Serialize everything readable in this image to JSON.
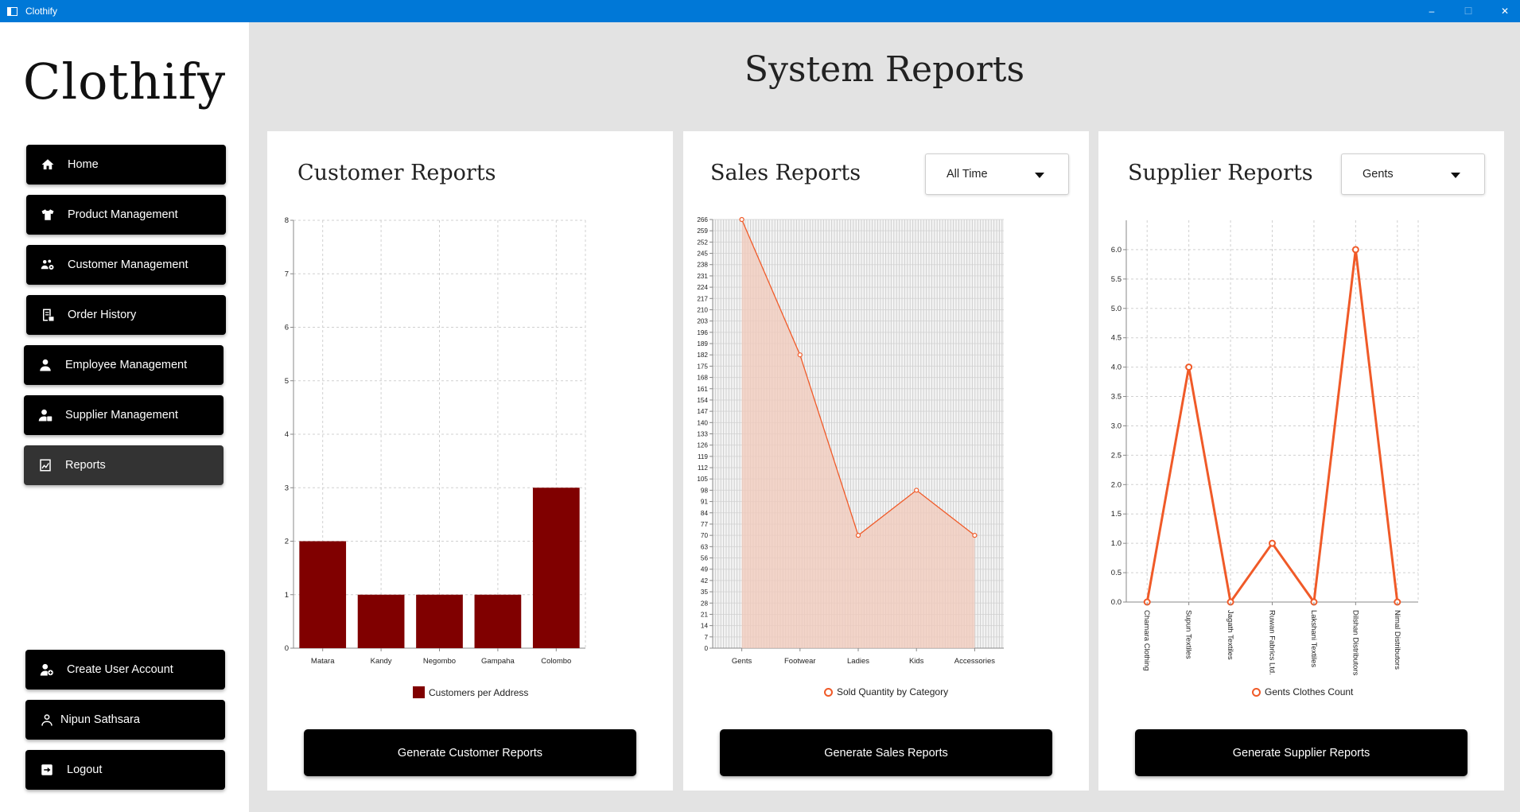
{
  "window": {
    "title": "Clothify",
    "min": "–",
    "max": "☐",
    "close": "✕"
  },
  "sidebar": {
    "logo": "Clothify",
    "items": [
      {
        "label": "Home",
        "icon": "home-icon"
      },
      {
        "label": "Product Management",
        "icon": "tshirt-icon"
      },
      {
        "label": "Customer Management",
        "icon": "users-cog-icon"
      },
      {
        "label": "Order History",
        "icon": "receipt-icon"
      },
      {
        "label": "Employee Management",
        "icon": "user-icon"
      },
      {
        "label": "Supplier Management",
        "icon": "user-tie-icon"
      },
      {
        "label": "Reports",
        "icon": "chart-icon",
        "active": true
      }
    ],
    "bottom": [
      {
        "label": "Create User Account",
        "icon": "user-plus-icon"
      },
      {
        "label": "Nipun Sathsara",
        "icon": "person-outline-icon"
      },
      {
        "label": "Logout",
        "icon": "logout-icon"
      }
    ]
  },
  "main": {
    "title": "System Reports"
  },
  "customer_card": {
    "title": "Customer Reports",
    "button": "Generate Customer Reports",
    "legend": "Customers per Address"
  },
  "sales_card": {
    "title": "Sales Reports",
    "dropdown": "All Time",
    "button": "Generate Sales Reports",
    "legend": "Sold Quantity by Category"
  },
  "supplier_card": {
    "title": "Supplier Reports",
    "dropdown": "Gents",
    "button": "Generate Supplier Reports",
    "legend": "Gents Clothes Count"
  },
  "colors": {
    "bar": "#800000",
    "line": "#f05a28",
    "area": "#f2c9bb",
    "black": "#000000",
    "background": "#e3e3e3"
  },
  "chart_data": [
    {
      "type": "bar",
      "categories": [
        "Matara",
        "Kandy",
        "Negombo",
        "Gampaha",
        "Colombo"
      ],
      "series": [
        {
          "name": "Customers per Address",
          "values": [
            2,
            1,
            1,
            1,
            3
          ]
        }
      ],
      "ylim": [
        0,
        8
      ],
      "yticks": [
        "0",
        "1",
        "2",
        "3",
        "4",
        "5",
        "6",
        "7",
        "8"
      ],
      "grid": true,
      "legend": "bottom"
    },
    {
      "type": "area",
      "categories": [
        "Gents",
        "Footwear",
        "Ladies",
        "Kids",
        "Accessories"
      ],
      "series": [
        {
          "name": "Sold Quantity by Category",
          "values": [
            266,
            182,
            70,
            98,
            70
          ]
        }
      ],
      "ylim": [
        0,
        266
      ],
      "yticks": [
        "0",
        "7",
        "14",
        "21",
        "28",
        "35",
        "42",
        "49",
        "56",
        "63",
        "70",
        "77",
        "84",
        "91",
        "98",
        "105",
        "112",
        "119",
        "126",
        "133",
        "140",
        "147",
        "154",
        "161",
        "168",
        "175",
        "182",
        "189",
        "196",
        "203",
        "210",
        "217",
        "224",
        "231",
        "238",
        "245",
        "252",
        "259",
        "266"
      ],
      "grid": true,
      "legend": "bottom"
    },
    {
      "type": "line",
      "categories": [
        "Chamara Clothing",
        "Supun Textiles",
        "Jagath Textiles",
        "Ruwan Fabrics Ltd.",
        "Lakshani Textiles",
        "Dilshan Distributors",
        "Nimal Distributors"
      ],
      "series": [
        {
          "name": "Gents Clothes Count",
          "values": [
            0,
            4,
            0,
            1,
            0,
            6,
            0
          ]
        }
      ],
      "ylim": [
        0,
        6.5
      ],
      "yticks": [
        "0.0",
        "0.5",
        "1.0",
        "1.5",
        "2.0",
        "2.5",
        "3.0",
        "3.5",
        "4.0",
        "4.5",
        "5.0",
        "5.5",
        "6.0"
      ],
      "grid": true,
      "legend": "bottom"
    }
  ]
}
